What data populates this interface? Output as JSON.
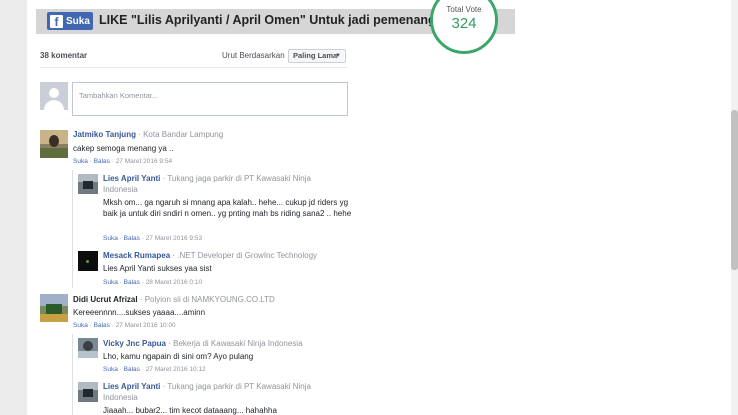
{
  "header": {
    "like_label": "Suka",
    "title": "LIKE \"Lilis Aprilyanti / April Omen\" Untuk jadi pemenang!"
  },
  "vote": {
    "label": "Total Vote",
    "count": "324"
  },
  "comments_header": {
    "count_label": "38 komentar",
    "sort_label": "Urut Berdasarkan",
    "sort_value": "Paling Lama"
  },
  "compose": {
    "placeholder": "Tambahkan Komentar..."
  },
  "actions": {
    "like": "Suka",
    "reply": "Balas",
    "sep": "·"
  },
  "comments": [
    {
      "name": "Jatmiko Tanjung",
      "meta": " · Kota Bandar Lampung",
      "text": "cakep semoga menang ya ..",
      "date": "27 Maret 2016 9:54"
    },
    {
      "name": "Lies April Yanti",
      "meta": " · Tukang jaga parkir di PT Kawasaki Ninja Indonesia",
      "text": "Mksh om... ga ngaruh si mnang apa kalah.. hehe... cukup jd riders yg baik ja untuk diri sndiri n omen.. yg pnting mah bs riding sana2 .. hehe",
      "date": "27 Maret 2016 9:53"
    },
    {
      "name": "Mesack Rumapea",
      "meta": " · .NET Developer di GrowInc Technology",
      "text": "Lies April Yanti sukses yaa sist",
      "date": "28 Maret 2016 0:10"
    },
    {
      "name": "Didi Ucrut Afrizal",
      "meta": " · Polyion sii di NAMKYOUNG.CO.LTD",
      "text": "Kereeennnn....sukses yaaaa....aminn",
      "date": "27 Maret 2016 10:00"
    },
    {
      "name": "Vicky Jnc Papua",
      "meta": " · Bekerja di Kawasaki Ninja Indonesia",
      "text": "Lho, kamu ngapain di sini om? Ayo pulang",
      "date": "27 Maret 2016 10:12"
    },
    {
      "name": "Lies April Yanti",
      "meta": " · Tukang jaga parkir di PT Kawasaki Ninja Indonesia",
      "text": "Jiaaah... bubar2... tim kecot dataaang... hahahha"
    }
  ]
}
